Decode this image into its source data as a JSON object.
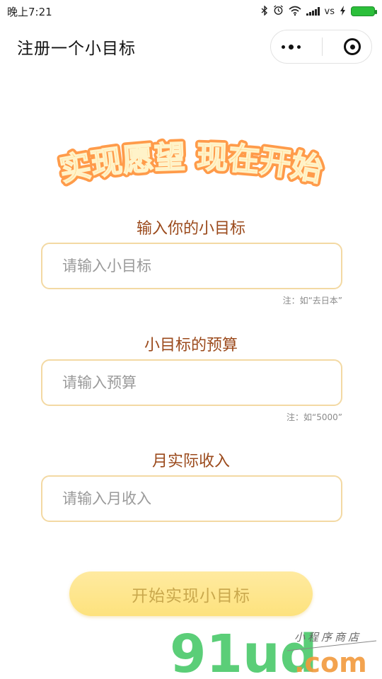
{
  "status_bar": {
    "time": "晚上7:21",
    "network_label": "vs",
    "icons": [
      "bluetooth-icon",
      "alarm-icon",
      "wifi-icon",
      "signal-icon",
      "charging-icon",
      "battery-icon"
    ]
  },
  "nav": {
    "title": "注册一个小目标",
    "capsule_icons": [
      "more-icon",
      "close-miniprogram-icon"
    ]
  },
  "banner": {
    "text": "实现愿望 现在开始"
  },
  "form": {
    "goal": {
      "label": "输入你的小目标",
      "placeholder": "请输入小目标",
      "value": "",
      "note": "注：如“去日本”"
    },
    "budget": {
      "label": "小目标的预算",
      "placeholder": "请输入预算",
      "value": "",
      "note": "注：如“5000”"
    },
    "income": {
      "label": "月实际收入",
      "placeholder": "请输入月收入",
      "value": ""
    },
    "submit_label": "开始实现小目标"
  },
  "watermark": {
    "logo": "91ud",
    "domain": ".com",
    "tagline": "小程序商店"
  },
  "colors": {
    "label": "#9b4a1c",
    "input_border": "#f3d9a3",
    "button_bg": "#fde27d",
    "button_text": "#c9a84d",
    "banner_text": "#ffb24a",
    "banner_outline": "#ff8a2b",
    "watermark_green": "#4ac96a",
    "watermark_orange": "#f29a3c"
  }
}
